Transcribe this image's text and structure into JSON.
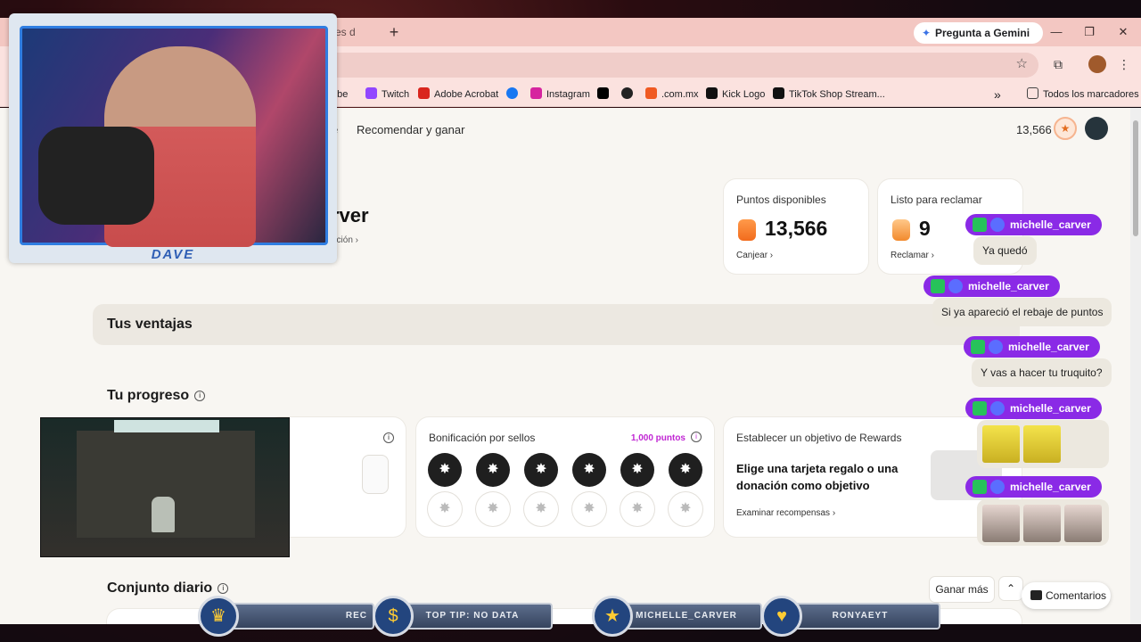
{
  "browser": {
    "tab_partial_title": "es d",
    "new_tab": "+",
    "gemini_label": "Pregunta a Gemini",
    "window_controls": [
      "—",
      "❐",
      "✕"
    ],
    "bookmarks": [
      {
        "label": "ube",
        "icon": "youtube-icon",
        "color": "#ff0000"
      },
      {
        "label": "Twitch",
        "icon": "twitch-icon",
        "color": "#9146ff"
      },
      {
        "label": "Adobe Acrobat",
        "icon": "acrobat-icon",
        "color": "#d9251d"
      },
      {
        "label": "",
        "icon": "facebook-icon",
        "color": "#1877f2"
      },
      {
        "label": "Instagram",
        "icon": "instagram-icon",
        "color": "#d6249f"
      },
      {
        "label": "",
        "icon": "x-icon",
        "color": "#000000"
      },
      {
        "label": "",
        "icon": "threads-icon",
        "color": "#222222"
      },
      {
        "label": ".com.mx",
        "icon": "mercado-icon",
        "color": "#f05a22"
      },
      {
        "label": "Kick Logo",
        "icon": "kick-icon",
        "color": "#111111"
      },
      {
        "label": "TikTok Shop Stream...",
        "icon": "tiktok-icon",
        "color": "#111111"
      }
    ],
    "more_bookmarks": "»",
    "all_bookmarks": "Todos los marcadores"
  },
  "page": {
    "nav_partial": "e",
    "nav_recomendar": "Recomendar y ganar",
    "header_points": "13,566",
    "username_partial": "rver",
    "sublink_partial": "ación",
    "puntos_card": {
      "label": "Puntos disponibles",
      "value": "13,566",
      "action": "Canjear"
    },
    "reclamar_card": {
      "label": "Listo para reclamar",
      "value": "9",
      "action": "Reclamar"
    },
    "ventajas": "Tus ventajas",
    "progreso": "Tu progreso",
    "sellos_card": {
      "label": "Bonificación por sellos",
      "points": "1,000 puntos",
      "filled": 6,
      "total": 12
    },
    "objetivo_card": {
      "label": "Establecer un objetivo de Rewards",
      "heading": "Elige una tarjeta regalo o una donación como objetivo",
      "action": "Examinar recompensas"
    },
    "conjunto": "Conjunto diario",
    "ganar_mas": "Ganar más",
    "comentarios": "Comentarios"
  },
  "stream": {
    "webcam_name": "DAVE",
    "chat": [
      {
        "user": "michelle_carver",
        "message": "Ya quedó"
      },
      {
        "user": "michelle_carver",
        "message": "Si ya apareció el rebaje de puntos"
      },
      {
        "user": "michelle_carver",
        "message": "Y vas a hacer tu truquito?"
      },
      {
        "user": "michelle_carver",
        "message": ""
      },
      {
        "user": "michelle_carver",
        "message": ""
      }
    ],
    "footer": [
      "REC",
      "TOP TIP: NO DATA",
      "MICHELLE_CARVER",
      "RONYAEYT"
    ]
  },
  "colors": {
    "accent": "#8a2ae6",
    "tab": "#f3c7c2",
    "points": "#c026d3"
  }
}
